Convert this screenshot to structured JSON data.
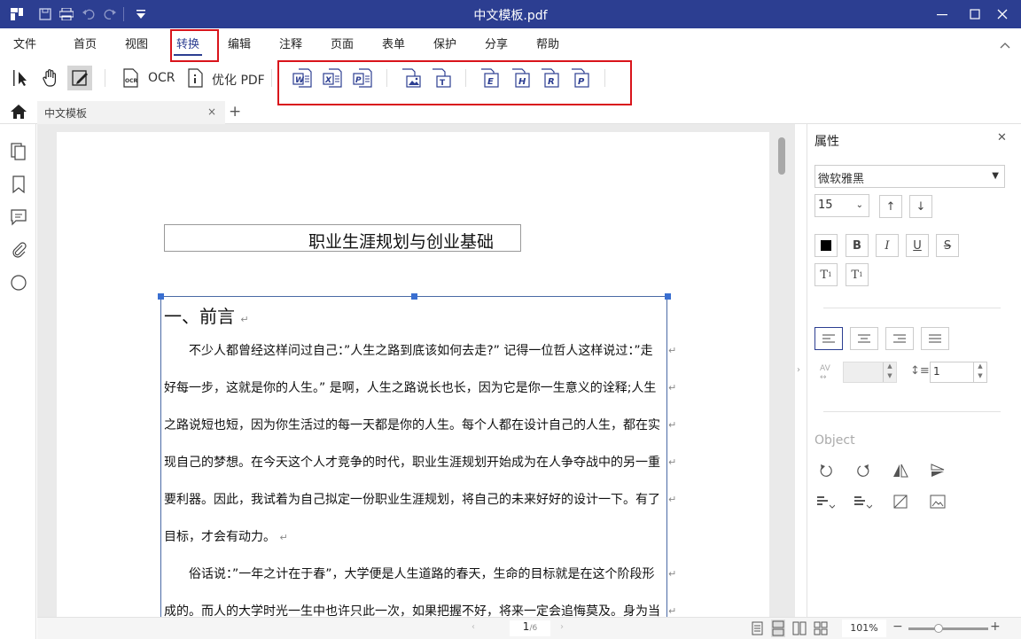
{
  "app": {
    "title": "中文模板.pdf",
    "accent": "#2c3e91",
    "highlight": "#d9141b"
  },
  "menu": {
    "items": [
      "文件",
      "首页",
      "视图",
      "转换",
      "编辑",
      "注释",
      "页面",
      "表单",
      "保护",
      "分享",
      "帮助"
    ],
    "active": "转换"
  },
  "toolbar": {
    "ocr_label": "OCR",
    "optimize_label": "优化 PDF",
    "convert_icons": [
      "to-word-icon",
      "to-excel-icon",
      "to-ppt-icon",
      "to-image-icon",
      "to-text-icon",
      "to-epub-icon",
      "to-html-icon",
      "to-rtf-icon",
      "to-pdfa-icon"
    ],
    "convert_letters": [
      "W",
      "X",
      "P",
      "",
      "T",
      "E",
      "H",
      "R",
      "P"
    ]
  },
  "tabs": [
    {
      "label": "中文模板",
      "close": "×"
    }
  ],
  "document": {
    "title": "职业生涯规划与创业基础",
    "heading": "一、前言",
    "lines": [
      "不少人都曾经这样问过自己：”人生之路到底该如何去走?” 记得一位哲人这样说过：”走",
      "好每一步，这就是你的人生。” 是啊，人生之路说长也长，因为它是你一生意义的诠释;人生",
      "之路说短也短，因为你生活过的每一天都是你的人生。每个人都在设计自己的人生，都在实",
      "现自己的梦想。在今天这个人才竞争的时代，职业生涯规划开始成为在人争夺战中的另一重",
      "要利器。因此，我试着为自己拟定一份职业生涯规划，将自己的未来好好的设计一下。有了",
      "目标，才会有动力。",
      "俗话说：”一年之计在于春”，大学便是人生道路的春天，生命的目标就是在这个阶段形",
      "成的。而人的大学时光一生中也许只此一次，如果把握不好，将来一定会追悔莫及。身为当"
    ]
  },
  "props": {
    "title": "属性",
    "font": "微软雅黑",
    "size": "15",
    "line_spacing": "1",
    "object_label": "Object"
  },
  "status": {
    "page_current": "1",
    "page_total": "/6",
    "zoom": "101%",
    "zoom_fraction": 0.38,
    "minus": "−",
    "plus": "+"
  }
}
